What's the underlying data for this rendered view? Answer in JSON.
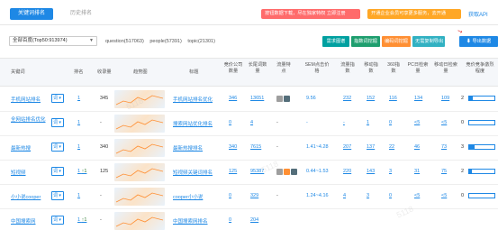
{
  "tabs": {
    "active": "关键词排名",
    "history": "历史排名"
  },
  "promos": {
    "p1": "按钮数据下载，尽在独家特权 立即注册",
    "p2": "开通企业会员可享更多服务，去开通",
    "api": "获取API"
  },
  "filter": {
    "select_value": "全部百度(Top50:913974)",
    "counts": [
      "question(517063)",
      "people(57391)",
      "topic(21301)"
    ]
  },
  "actions": [
    "需求图谱",
    "指数词挖掘",
    "编码词挖掘",
    "无需复制导出",
    "导出数据"
  ],
  "headers": [
    "关键词",
    "排名",
    "收录量",
    "趋势图",
    "标题",
    "竞价公司数量",
    "长尾词数量",
    "流量特点",
    "SEM点击价格",
    "流量指数",
    "移动指数",
    "360指数",
    "PC日检索量",
    "移动日检索量",
    "竞价竞争激烈程度"
  ],
  "rows": [
    {
      "keyword": "手机网站排名",
      "rank": "1",
      "index": "345",
      "title": "手机网站排名优化",
      "bid": "346",
      "long": "13651",
      "sem": "9.56",
      "flow": "232",
      "mobile": "152",
      "s360": "116",
      "pc": "134",
      "mday": "109",
      "comp": "2",
      "badges": [
        "#9e9e9e",
        "#546e7a"
      ],
      "level": 0.15
    },
    {
      "keyword": "全网站排名优化",
      "rank": "1",
      "index": "-",
      "title": "搜索网站优化排名",
      "bid": "0",
      "long": "4",
      "sem": "-",
      "flow": "-",
      "mobile": "1",
      "s360": "0",
      "pc": "<5",
      "mday": "<5",
      "comp": "0",
      "badges": [],
      "level": 0.0
    },
    {
      "keyword": "最新热搜",
      "rank": "1",
      "index": "340",
      "title": "最新热搜排名",
      "bid": "340",
      "long": "7615",
      "sem": "1.41~4.28",
      "flow": "207",
      "mobile": "137",
      "s360": "22",
      "pc": "46",
      "mday": "73",
      "comp": "3",
      "badges": [],
      "level": 0.2
    },
    {
      "keyword": "短视频",
      "rank": "1 ↑1",
      "index": "125",
      "title": "短视频关键词排名",
      "bid": "125",
      "long": "95387",
      "sem": "0.44~1.53",
      "flow": "220",
      "mobile": "143",
      "s360": "3",
      "pc": "31",
      "mday": "75",
      "comp": "2",
      "badges": [
        "#9e9e9e",
        "#ff8f33",
        "#546e7a"
      ],
      "level": 0.1
    },
    {
      "keyword": "小小说cooper",
      "rank": "1",
      "index": "-",
      "title": "cooper小小说",
      "bid": "0",
      "long": "329",
      "sem": "1.24~4.16",
      "flow": "4",
      "mobile": "3",
      "s360": "0",
      "pc": "<5",
      "mday": "<5",
      "comp": "0",
      "badges": [],
      "level": 0.0
    },
    {
      "keyword": "中国搜索网",
      "rank": "1 ↑1",
      "index": "-",
      "title": "中国搜索网排名",
      "bid": "0",
      "long": "204",
      "sem": "",
      "flow": "",
      "mobile": "",
      "s360": "",
      "pc": "",
      "mday": "",
      "comp": "",
      "badges": [],
      "level": 0.0
    }
  ],
  "dd_label": "词 ▾",
  "colors": {
    "accent": "#1e88e5",
    "orange": "#ff8f33",
    "red": "#ff6b6b"
  }
}
